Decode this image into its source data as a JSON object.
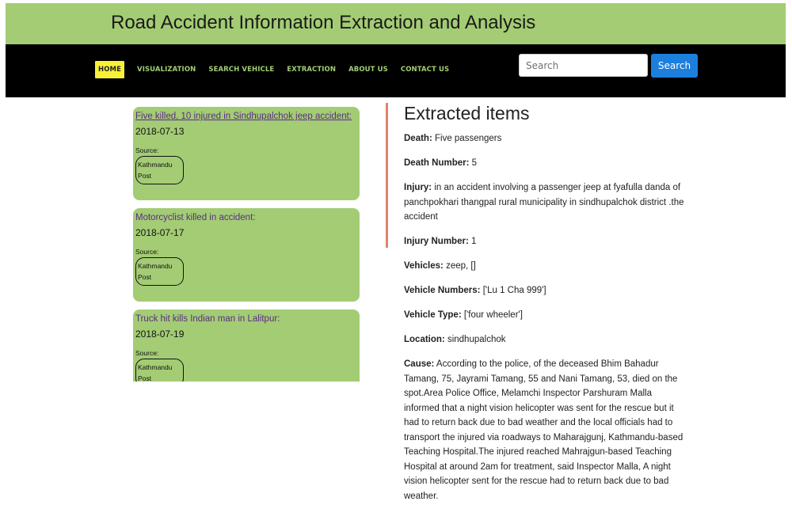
{
  "header": {
    "title": "Road Accident Information Extraction and Analysis"
  },
  "nav": {
    "items": [
      {
        "label": "HOME"
      },
      {
        "label": "VISUALIZATION"
      },
      {
        "label": "SEARCH VEHICLE"
      },
      {
        "label": "EXTRACTION"
      },
      {
        "label": "ABOUT US"
      },
      {
        "label": "CONTACT US"
      }
    ],
    "search_placeholder": "Search",
    "search_button": "Search"
  },
  "colors": {
    "accent_green": "#a3cc74",
    "active_nav": "#f7f236",
    "search_blue": "#1c7fdd",
    "divider": "#e0856a"
  },
  "news": [
    {
      "title": "Five killed, 10 injured in Sindhupalchok jeep accident:",
      "date": "2018-07-13",
      "source_label": "Source:",
      "source_line1": "Kathmandu",
      "source_line2": "Post"
    },
    {
      "title": "Motorcyclist killed in accident:",
      "date": "2018-07-17",
      "source_label": "Source:",
      "source_line1": "Kathmandu",
      "source_line2": "Post"
    },
    {
      "title": "Truck hit kills Indian man in Lalitpur:",
      "date": "2018-07-19",
      "source_label": "Source:",
      "source_line1": "Kathmandu",
      "source_line2": "Post"
    }
  ],
  "extracted": {
    "heading": "Extracted items",
    "fields": [
      {
        "label": "Death:",
        "value": "Five passengers"
      },
      {
        "label": "Death Number:",
        "value": "5"
      },
      {
        "label": "Injury:",
        "value": "in an accident involving a passenger jeep at fyafulla danda of panchpokhari thangpal rural municipality in sindhupalchok district .the accident"
      },
      {
        "label": "Injury Number:",
        "value": "1"
      },
      {
        "label": "Vehicles:",
        "value": "zeep, []"
      },
      {
        "label": "Vehicle Numbers:",
        "value": "['Lu 1 Cha 999']"
      },
      {
        "label": "Vehicle Type:",
        "value": "['four wheeler']"
      },
      {
        "label": "Location:",
        "value": "sindhupalchok"
      },
      {
        "label": "Cause:",
        "value": "According to the police, of the deceased Bhim Bahadur Tamang, 75, Jayrami Tamang, 55 and Nani Tamang, 53, died on the spot.Area Police Office, Melamchi Inspector Parshuram Malla informed that a night vision helicopter was sent for the rescue but it had to return back due to bad weather and the local officials had to transport the injured via roadways to Maharajgunj, Kathmandu-based Teaching Hospital.The injured reached Mahrajgun-based Teaching Hospital at around 2am for treatment, said Inspector Malla, A night vision helicopter sent for the rescue had to return back due to bad weather."
      }
    ]
  }
}
